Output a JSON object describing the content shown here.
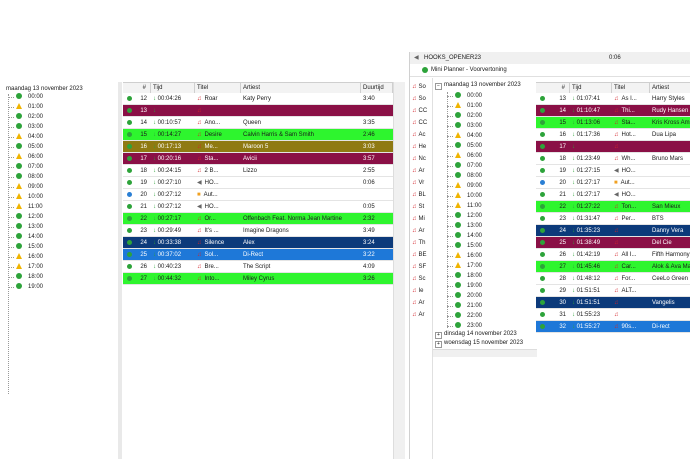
{
  "left": {
    "date": "maandag 13 november 2023",
    "hours": [
      {
        "t": "00:00",
        "s": "ok"
      },
      {
        "t": "01:00",
        "s": "warn"
      },
      {
        "t": "02:00",
        "s": "ok"
      },
      {
        "t": "03:00",
        "s": "ok"
      },
      {
        "t": "04:00",
        "s": "warn"
      },
      {
        "t": "05:00",
        "s": "ok"
      },
      {
        "t": "06:00",
        "s": "warn"
      },
      {
        "t": "07:00",
        "s": "ok"
      },
      {
        "t": "08:00",
        "s": "ok"
      },
      {
        "t": "09:00",
        "s": "warn"
      },
      {
        "t": "10:00",
        "s": "warn"
      },
      {
        "t": "11:00",
        "s": "warn"
      },
      {
        "t": "12:00",
        "s": "ok"
      },
      {
        "t": "13:00",
        "s": "ok"
      },
      {
        "t": "14:00",
        "s": "ok"
      },
      {
        "t": "15:00",
        "s": "ok"
      },
      {
        "t": "16:00",
        "s": "warn"
      },
      {
        "t": "17:00",
        "s": "warn"
      },
      {
        "t": "18:00",
        "s": "ok"
      },
      {
        "t": "19:00",
        "s": "ok"
      }
    ],
    "columns": [
      "#",
      "Tijd",
      "Titel",
      "Artiest",
      "Duurtijd"
    ],
    "rows": [
      {
        "n": "12",
        "tijd": "00:04:26",
        "icon": "note",
        "titel": "Roar",
        "artiest": "Katy Perry",
        "duur": "3:40",
        "bg": "#ffffff",
        "fg": "#1a1a1a",
        "dot": "#2da33a"
      },
      {
        "n": "13",
        "tijd": "",
        "icon": "note",
        "titel": "",
        "artiest": "",
        "duur": "",
        "bg": "#8a1046",
        "fg": "#ffffff",
        "dot": "#2da33a"
      },
      {
        "n": "14",
        "tijd": "00:10:57",
        "icon": "note",
        "titel": "Ano...",
        "artiest": "Queen",
        "duur": "3:35",
        "bg": "#ffffff",
        "fg": "#1a1a1a",
        "dot": "#2da33a"
      },
      {
        "n": "15",
        "tijd": "00:14:27",
        "icon": "note",
        "titel": "Desire",
        "artiest": "Calvin Harris & Sam Smith",
        "duur": "2:46",
        "bg": "#2ef52e",
        "fg": "#1a1a1a",
        "dot": "#2da33a"
      },
      {
        "n": "16",
        "tijd": "00:17:13",
        "icon": "note",
        "titel": "Me...",
        "artiest": "Maroon 5",
        "duur": "3:03",
        "bg": "#8f7a12",
        "fg": "#ffffff",
        "dot": "#2da33a"
      },
      {
        "n": "17",
        "tijd": "00:20:16",
        "icon": "note",
        "titel": "Sta...",
        "artiest": "Avicii",
        "duur": "3:57",
        "bg": "#8a1046",
        "fg": "#ffffff",
        "dot": "#2da33a"
      },
      {
        "n": "18",
        "tijd": "00:24:15",
        "icon": "note",
        "titel": "2 B...",
        "artiest": "Lizzo",
        "duur": "2:55",
        "bg": "#ffffff",
        "fg": "#1a1a1a",
        "dot": "#2da33a"
      },
      {
        "n": "19",
        "tijd": "00:27:10",
        "icon": "spk",
        "titel": "HO...",
        "artiest": "",
        "duur": "0:06",
        "bg": "#ffffff",
        "fg": "#1a1a1a",
        "dot": "#2da33a"
      },
      {
        "n": "20",
        "tijd": "00:27:12",
        "icon": "box",
        "titel": "Aut...",
        "artiest": "",
        "duur": "",
        "bg": "#ffffff",
        "fg": "#1a1a1a",
        "dot": "#2a7fd4"
      },
      {
        "n": "21",
        "tijd": "00:27:12",
        "icon": "spk",
        "titel": "HO...",
        "artiest": "",
        "duur": "0:05",
        "bg": "#ffffff",
        "fg": "#1a1a1a",
        "dot": "#2da33a"
      },
      {
        "n": "22",
        "tijd": "00:27:17",
        "icon": "note",
        "titel": "Or...",
        "artiest": "Offenbach Feat. Norma Jean Martine",
        "duur": "2:32",
        "bg": "#2ef52e",
        "fg": "#1a1a1a",
        "dot": "#2da33a"
      },
      {
        "n": "23",
        "tijd": "00:29:49",
        "icon": "note",
        "titel": "It's ...",
        "artiest": "Imagine Dragons",
        "duur": "3:49",
        "bg": "#ffffff",
        "fg": "#1a1a1a",
        "dot": "#2da33a"
      },
      {
        "n": "24",
        "tijd": "00:33:38",
        "icon": "note",
        "titel": "Silence",
        "artiest": "Alex",
        "duur": "3:24",
        "bg": "#0c3a7a",
        "fg": "#ffffff",
        "dot": "#2da33a"
      },
      {
        "n": "25",
        "tijd": "00:37:02",
        "icon": "note",
        "titel": "Sol...",
        "artiest": "Di-Rect",
        "duur": "3:22",
        "bg": "#1e78d8",
        "fg": "#ffffff",
        "dot": "#2da33a"
      },
      {
        "n": "26",
        "tijd": "00:40:23",
        "icon": "note",
        "titel": "Bre...",
        "artiest": "The Script",
        "duur": "4:09",
        "bg": "#ffffff",
        "fg": "#1a1a1a",
        "dot": "#2da33a"
      },
      {
        "n": "27",
        "tijd": "00:44:32",
        "icon": "note",
        "titel": "Into...",
        "artiest": "Miley Cyrus",
        "duur": "3:26",
        "bg": "#2ef52e",
        "fg": "#1a1a1a",
        "dot": "#2da33a"
      }
    ]
  },
  "right": {
    "title_bar": "HOOKS_OPENER23",
    "title_time": "0:06",
    "window_title": "Mini Planner - Voorvertoning",
    "side_labels": [
      "So",
      "So",
      "CC",
      "CC",
      "Ac",
      "He",
      "Nc",
      "Ar",
      "Vr",
      "BL",
      "St",
      "Mi",
      "Ar",
      "Th",
      "BE",
      "SF",
      "Sc",
      "Ie",
      "Ar",
      "Ar"
    ],
    "tree_date": "maandag 13 november 2023",
    "hours": [
      {
        "t": "00:00",
        "s": "ok"
      },
      {
        "t": "01:00",
        "s": "warn"
      },
      {
        "t": "02:00",
        "s": "ok"
      },
      {
        "t": "03:00",
        "s": "ok"
      },
      {
        "t": "04:00",
        "s": "warn"
      },
      {
        "t": "05:00",
        "s": "ok"
      },
      {
        "t": "06:00",
        "s": "warn"
      },
      {
        "t": "07:00",
        "s": "ok"
      },
      {
        "t": "08:00",
        "s": "ok"
      },
      {
        "t": "09:00",
        "s": "warn"
      },
      {
        "t": "10:00",
        "s": "warn"
      },
      {
        "t": "11:00",
        "s": "warn"
      },
      {
        "t": "12:00",
        "s": "ok"
      },
      {
        "t": "13:00",
        "s": "ok"
      },
      {
        "t": "14:00",
        "s": "ok"
      },
      {
        "t": "15:00",
        "s": "ok"
      },
      {
        "t": "16:00",
        "s": "warn"
      },
      {
        "t": "17:00",
        "s": "warn"
      },
      {
        "t": "18:00",
        "s": "ok"
      },
      {
        "t": "19:00",
        "s": "ok"
      },
      {
        "t": "20:00",
        "s": "ok"
      },
      {
        "t": "21:00",
        "s": "ok"
      },
      {
        "t": "22:00",
        "s": "ok"
      },
      {
        "t": "23:00",
        "s": "ok"
      }
    ],
    "more_dates": [
      "dinsdag 14 november 2023",
      "woensdag 15 november 2023"
    ],
    "columns": [
      "#",
      "Tijd",
      "Titel",
      "Artiest"
    ],
    "rows": [
      {
        "n": "13",
        "tijd": "01:07:41",
        "icon": "note",
        "titel": "As I...",
        "artiest": "Harry Styles",
        "bg": "#ffffff",
        "fg": "#1a1a1a",
        "dot": "#2da33a"
      },
      {
        "n": "14",
        "tijd": "01:10:47",
        "icon": "note",
        "titel": "Thi...",
        "artiest": "Rudy Hansen",
        "bg": "#8a1046",
        "fg": "#ffffff",
        "dot": "#2da33a"
      },
      {
        "n": "15",
        "tijd": "01:13:06",
        "icon": "note",
        "titel": "Sta...",
        "artiest": "Kris Kross Amst",
        "bg": "#2ef52e",
        "fg": "#1a1a1a",
        "dot": "#2da33a"
      },
      {
        "n": "16",
        "tijd": "01:17:36",
        "icon": "note",
        "titel": "Hot...",
        "artiest": "Dua Lipa",
        "bg": "#ffffff",
        "fg": "#1a1a1a",
        "dot": "#2da33a"
      },
      {
        "n": "17",
        "tijd": "",
        "icon": "note",
        "titel": "",
        "artiest": "",
        "bg": "#8a1046",
        "fg": "#ffffff",
        "dot": "#2da33a"
      },
      {
        "n": "18",
        "tijd": "01:23:49",
        "icon": "note",
        "titel": "Wh...",
        "artiest": "Bruno Mars",
        "bg": "#ffffff",
        "fg": "#1a1a1a",
        "dot": "#2da33a"
      },
      {
        "n": "19",
        "tijd": "01:27:15",
        "icon": "spk",
        "titel": "HO...",
        "artiest": "",
        "bg": "#ffffff",
        "fg": "#1a1a1a",
        "dot": "#2da33a"
      },
      {
        "n": "20",
        "tijd": "01:27:17",
        "icon": "box",
        "titel": "Aut...",
        "artiest": "",
        "bg": "#ffffff",
        "fg": "#1a1a1a",
        "dot": "#2a7fd4"
      },
      {
        "n": "21",
        "tijd": "01:27:17",
        "icon": "spk",
        "titel": "HO...",
        "artiest": "",
        "bg": "#ffffff",
        "fg": "#1a1a1a",
        "dot": "#2da33a"
      },
      {
        "n": "22",
        "tijd": "01:27:22",
        "icon": "note",
        "titel": "Ton...",
        "artiest": "San Mieux",
        "bg": "#2ef52e",
        "fg": "#1a1a1a",
        "dot": "#2da33a"
      },
      {
        "n": "23",
        "tijd": "01:31:47",
        "icon": "note",
        "titel": "Per...",
        "artiest": "BTS",
        "bg": "#ffffff",
        "fg": "#1a1a1a",
        "dot": "#2da33a"
      },
      {
        "n": "24",
        "tijd": "01:35:23",
        "icon": "note",
        "titel": "",
        "artiest": "Danny Vera",
        "bg": "#0c3a7a",
        "fg": "#ffffff",
        "dot": "#2da33a"
      },
      {
        "n": "25",
        "tijd": "01:38:49",
        "icon": "note",
        "titel": "",
        "artiest": "Del Cie",
        "bg": "#8a1046",
        "fg": "#ffffff",
        "dot": "#2da33a"
      },
      {
        "n": "26",
        "tijd": "01:42:19",
        "icon": "note",
        "titel": "All I...",
        "artiest": "Fifth Harmony f",
        "bg": "#ffffff",
        "fg": "#1a1a1a",
        "dot": "#2da33a"
      },
      {
        "n": "27",
        "tijd": "01:45:46",
        "icon": "note",
        "titel": "Car...",
        "artiest": "Alok & Ava Max",
        "bg": "#2ef52e",
        "fg": "#1a1a1a",
        "dot": "#2da33a"
      },
      {
        "n": "28",
        "tijd": "01:48:12",
        "icon": "note",
        "titel": "For...",
        "artiest": "CeeLo Green",
        "bg": "#ffffff",
        "fg": "#1a1a1a",
        "dot": "#2da33a"
      },
      {
        "n": "29",
        "tijd": "01:51:51",
        "icon": "note",
        "titel": "ALT...",
        "artiest": "",
        "bg": "#ffffff",
        "fg": "#1a1a1a",
        "dot": "#2da33a"
      },
      {
        "n": "30",
        "tijd": "01:51:51",
        "icon": "note",
        "titel": "",
        "artiest": "Vangelis",
        "bg": "#0c3a7a",
        "fg": "#ffffff",
        "dot": "#2da33a"
      },
      {
        "n": "31",
        "tijd": "01:55:23",
        "icon": "note",
        "titel": "",
        "artiest": "",
        "bg": "#ffffff",
        "fg": "#1a1a1a",
        "dot": "#2da33a"
      },
      {
        "n": "32",
        "tijd": "01:55:27",
        "icon": "note",
        "titel": "90s...",
        "artiest": "Di-rect",
        "bg": "#1e78d8",
        "fg": "#ffffff",
        "dot": "#2da33a"
      }
    ]
  }
}
